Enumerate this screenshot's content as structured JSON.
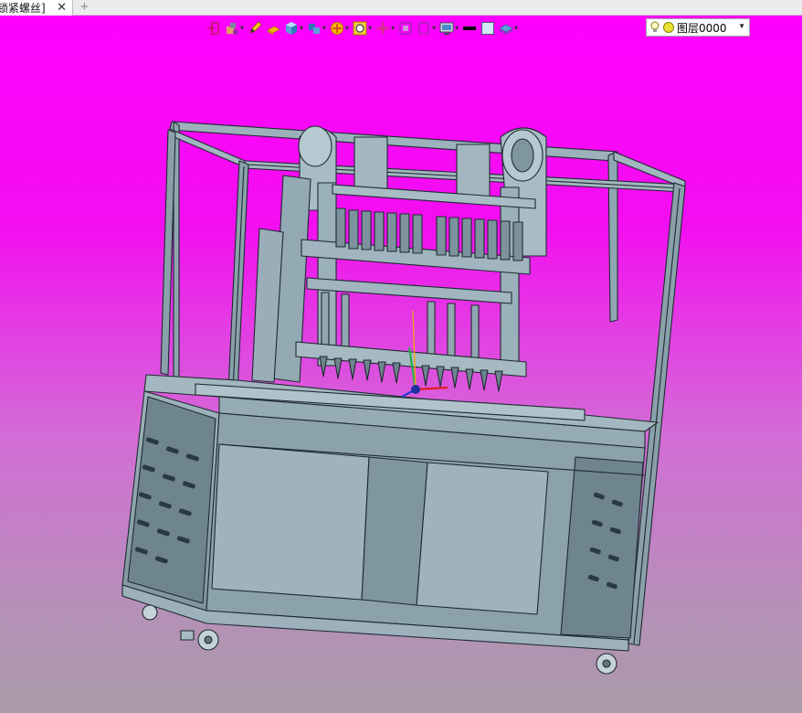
{
  "tab": {
    "title": "锁紧螺丝]",
    "close_glyph": "✕",
    "new_glyph": "+"
  },
  "toolbar": {
    "items": [
      {
        "name": "exit-sketch-icon"
      },
      {
        "name": "view-orient-icon",
        "dropdown": true
      },
      {
        "name": "pencil-icon"
      },
      {
        "name": "face-select-icon"
      },
      {
        "name": "cube-display-icon",
        "dropdown": true
      },
      {
        "name": "view-cube-icon",
        "dropdown": true
      },
      {
        "name": "render-style-icon",
        "dropdown": true
      },
      {
        "name": "zoom-icon",
        "dropdown": true
      },
      {
        "name": "pan-target-icon",
        "dropdown": true
      },
      {
        "name": "section-view-icon"
      },
      {
        "name": "rectangle-icon",
        "dropdown": true
      },
      {
        "name": "monitor-icon",
        "dropdown": true
      },
      {
        "name": "line-color-icon"
      },
      {
        "name": "fill-color-icon"
      },
      {
        "name": "layer-stack-icon",
        "dropdown": true
      }
    ]
  },
  "layer_selector": {
    "value": "图层0000"
  },
  "colors": {
    "background_top": "#ff00ff",
    "background_bottom": "#a99ba8",
    "model_fill": "#8fa7b2",
    "model_edge": "#1e2a30"
  }
}
